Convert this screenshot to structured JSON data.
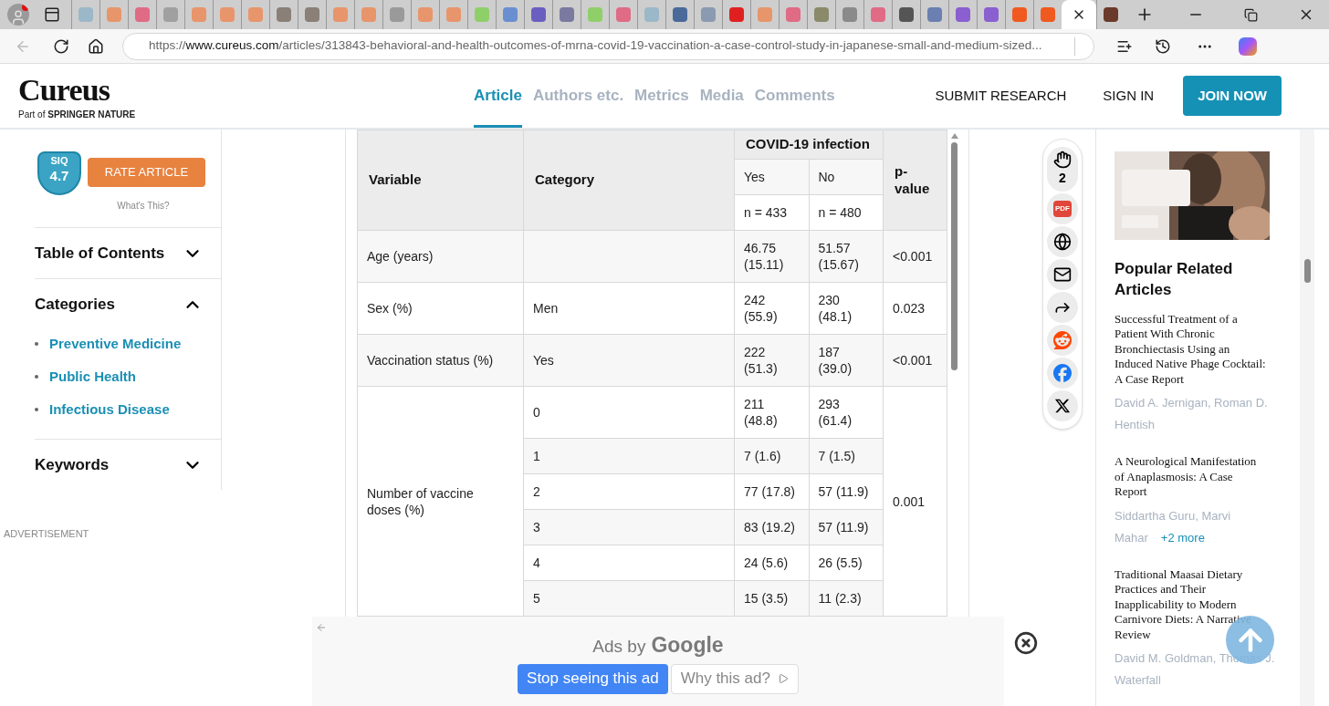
{
  "browser": {
    "tabs": [
      {
        "color": "#9bb8c8",
        "selected": false
      },
      {
        "color": "#e8956b",
        "selected": false
      },
      {
        "color": "#e06b85",
        "selected": false
      },
      {
        "color": "#a0a0a0",
        "selected": false
      },
      {
        "color": "#e8956b",
        "selected": false
      },
      {
        "color": "#e8956b",
        "selected": false
      },
      {
        "color": "#e8956b",
        "selected": false
      },
      {
        "color": "#8a8078",
        "selected": false
      },
      {
        "color": "#8a8078",
        "selected": false
      },
      {
        "color": "#e8956b",
        "selected": false
      },
      {
        "color": "#e8956b",
        "selected": false
      },
      {
        "color": "#9a9a9a",
        "selected": false
      },
      {
        "color": "#e8956b",
        "selected": false
      },
      {
        "color": "#e8956b",
        "selected": false
      },
      {
        "color": "#8fcf6a",
        "selected": false
      },
      {
        "color": "#6a8fd0",
        "selected": false
      },
      {
        "color": "#6a5fc0",
        "selected": false
      },
      {
        "color": "#7a7aa0",
        "selected": false
      },
      {
        "color": "#8fcf6a",
        "selected": false
      },
      {
        "color": "#e06b85",
        "selected": false
      },
      {
        "color": "#9bb8c8",
        "selected": false
      },
      {
        "color": "#4a6a9a",
        "selected": false
      },
      {
        "color": "#8a9ab0",
        "selected": false
      },
      {
        "color": "#e02020",
        "selected": false
      },
      {
        "color": "#e8956b",
        "selected": false
      },
      {
        "color": "#e06b85",
        "selected": false
      },
      {
        "color": "#8a8a6a",
        "selected": false
      },
      {
        "color": "#8a8a8a",
        "selected": false
      },
      {
        "color": "#e06b85",
        "selected": false
      },
      {
        "color": "#555555",
        "selected": false
      },
      {
        "color": "#6a80b0",
        "selected": false
      },
      {
        "color": "#8a5fd0",
        "selected": false
      },
      {
        "color": "#8a5fd0",
        "selected": false
      },
      {
        "color": "#f05a20",
        "selected": false
      },
      {
        "color": "#f05a20",
        "selected": false
      },
      {
        "color": "#ffffff",
        "selected": true
      },
      {
        "color": "#6a3a2a",
        "selected": false
      }
    ],
    "url": {
      "scheme": "https://",
      "host": "www.cureus.com",
      "path": "/articles/313843-behavioral-and-health-outcomes-of-mrna-covid-19-vaccination-a-case-control-study-in-japanese-small-and-medium-sized..."
    }
  },
  "header": {
    "logo": "Cureus",
    "tagline": "Part of **SPRINGER NATURE**",
    "tabs": [
      {
        "label": "Article",
        "selected": true
      },
      {
        "label": "Authors etc.",
        "selected": false
      },
      {
        "label": "Metrics",
        "selected": false
      },
      {
        "label": "Media",
        "selected": false
      },
      {
        "label": "Comments",
        "selected": false
      }
    ],
    "links": [
      "SUBMIT RESEARCH",
      "SIGN IN"
    ],
    "join": "JOIN NOW"
  },
  "sidebar": {
    "siq_label": "SIQ",
    "siq_score": "4.7",
    "rate_button": "RATE ARTICLE",
    "whats_this": "What's This?",
    "sections": [
      {
        "title": "Table of Contents",
        "expanded": false
      },
      {
        "title": "Categories",
        "expanded": true,
        "items": [
          "Preventive Medicine",
          "Public Health",
          "Infectious Disease"
        ]
      },
      {
        "title": "Keywords",
        "expanded": false
      }
    ],
    "advertisement": "ADVERTISEMENT"
  },
  "table": {
    "headers": {
      "variable": "Variable",
      "category": "Category",
      "group": "COVID-19 infection",
      "yes": "Yes",
      "no": "No",
      "p": "p-value",
      "n_yes": "n = 433",
      "n_no": "n = 480"
    },
    "rows": [
      {
        "variable": "Age (years)",
        "p_value": "<0.001",
        "sub": [
          {
            "yes": "46.75 (15.11)",
            "no": "51.57 (15.67)"
          }
        ]
      },
      {
        "variable": "Sex (%)",
        "p_value": "0.023",
        "sub": [
          {
            "category": "Men",
            "yes": "242 (55.9)",
            "no": "230 (48.1)"
          }
        ]
      },
      {
        "variable": "Vaccination status (%)",
        "p_value": "<0.001",
        "sub": [
          {
            "category": "Yes",
            "yes": "222 (51.3)",
            "no": "187 (39.0)"
          }
        ]
      },
      {
        "variable": "Number of vaccine doses (%)",
        "p_value": "0.001",
        "sub": [
          {
            "category": "0",
            "yes": "211 (48.8)",
            "no": "293 (61.4)"
          },
          {
            "category": "1",
            "yes": "7 (1.6)",
            "no": "7 (1.5)"
          },
          {
            "category": "2",
            "yes": "77 (17.8)",
            "no": "57 (11.9)"
          },
          {
            "category": "3",
            "yes": "83 (19.2)",
            "no": "57 (11.9)"
          },
          {
            "category": "4",
            "yes": "24 (5.6)",
            "no": "26 (5.5)"
          },
          {
            "category": "5",
            "yes": "15 (3.5)",
            "no": "11 (2.3)"
          }
        ]
      }
    ]
  },
  "share": {
    "clap_count": "2",
    "pdf": "PDF"
  },
  "related": {
    "title": "Popular Related Articles",
    "articles": [
      {
        "title": "Successful Treatment of a Patient With Chronic Bronchiectasis Using an Induced Native Phage Cocktail: A Case Report",
        "authors": "David A. Jernigan, Roman D. Hentish"
      },
      {
        "title": "A Neurological Manifestation of Anaplasmosis: A Case Report",
        "authors": "Siddartha Guru, Marvi Mahar",
        "more": "+2 more"
      },
      {
        "title": "Traditional Maasai Dietary Practices and Their Inapplicability to Modern Carnivore Diets: A Narrative Review",
        "authors": "David M. Goldman, Thomas J. Waterfall"
      }
    ]
  },
  "ad": {
    "ads_by": "Ads by",
    "google": "Google",
    "stop": "Stop seeing this ad",
    "why": "Why this ad?"
  }
}
